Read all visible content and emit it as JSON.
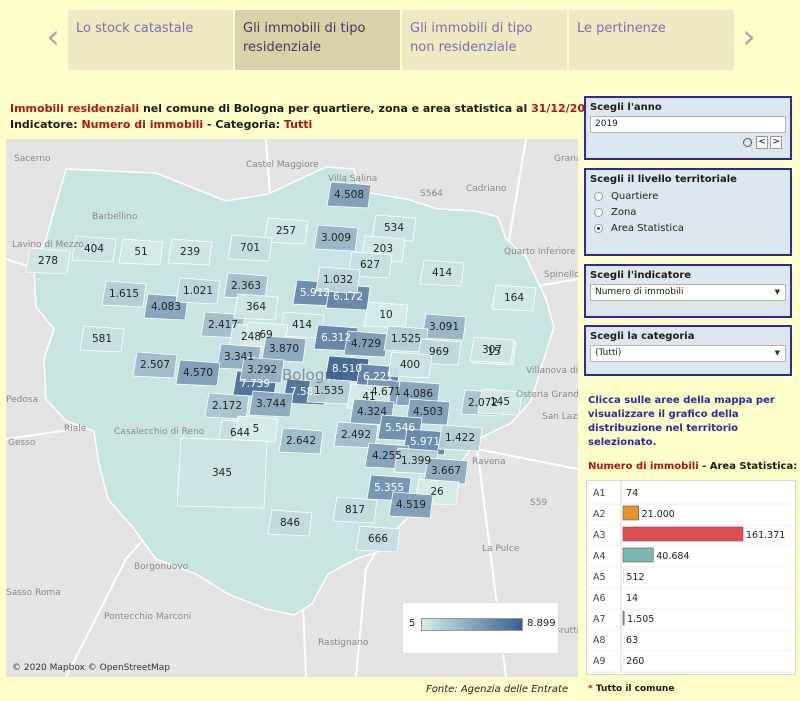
{
  "nav": {
    "tabs": [
      {
        "label": "Lo stock catastale",
        "active": false
      },
      {
        "label": "Gli immobili di tipo residenziale",
        "active": true
      },
      {
        "label": "Gli immobili di tipo non residenziale",
        "active": false
      },
      {
        "label": "Le pertinenze",
        "active": false
      }
    ],
    "prev_icon": "‹",
    "next_icon": "›"
  },
  "header": {
    "line1_prefix": "Immobili residenziali",
    "line1_middle": " nel comune di Bologna per quartiere, zona e area statistica al ",
    "line1_date": "31/12/2019",
    "line2_label": "Indicatore: ",
    "line2_indicator": "Numero di immobili",
    "line2_middle": " - Categoria: ",
    "line2_category": "Tutti"
  },
  "map": {
    "attribution": "© 2020 Mapbox © OpenStreetMap",
    "city_label": "Bologna",
    "legend": {
      "min": "5",
      "max": "8.899",
      "color_min": "#d6ede9",
      "color_max": "#3a5f8f"
    },
    "places": [
      "Sacerno",
      "Castel Maggiore",
      "Villa Salina",
      "Granarolo dell'E",
      "Cadriano",
      "Barbellino",
      "Lavino di Mezzo",
      "Quarto Inferiore",
      "Spinello",
      "Villanova di Castenaso",
      "Osteria Grande",
      "Riale",
      "Casalecchio di Reno",
      "Gesso",
      "Pedosa",
      "Ravena",
      "Borgonuovo",
      "Sasso Roma",
      "Pontecchio Marconi",
      "La Pulce",
      "Montecalvo",
      "Rastignano",
      "San Lazzaro",
      "Brutti",
      "S564",
      "S59"
    ],
    "area_values": [
      "278",
      "404",
      "51",
      "239",
      "257",
      "701",
      "4.508",
      "3.009",
      "534",
      "203",
      "627",
      "414",
      "164",
      "1.615",
      "4.083",
      "1.021",
      "2.363",
      "5.912",
      "6.172",
      "1.032",
      "581",
      "2.417",
      "364",
      "414",
      "10",
      "3.091",
      "2.507",
      "248",
      "69",
      "3.870",
      "6.312",
      "4.729",
      "1.525",
      "969",
      "15",
      "307",
      "3.341",
      "4.570",
      "8.510",
      "6.221",
      "4.671",
      "400",
      "7.739",
      "3.292",
      "7.581",
      "1.535",
      "41",
      "4.086",
      "2.072",
      "145",
      "2.172",
      "3.744",
      "4.324",
      "4.503",
      "644",
      "5",
      "2.642",
      "2.492",
      "5.546",
      "5.971",
      "1.422",
      "4.255",
      "1.399",
      "3.667",
      "345",
      "5.355",
      "26",
      "4.519",
      "846",
      "817",
      "666"
    ]
  },
  "source": "Fonte: Agenzia delle Entrate",
  "controls": {
    "year": {
      "title": "Scegli l'anno",
      "value": "2019",
      "prev": "<",
      "next": ">"
    },
    "level": {
      "title": "Scegli il livello territoriale",
      "options": [
        "Quartiere",
        "Zona",
        "Area Statistica"
      ],
      "selected": "Area Statistica"
    },
    "indicator": {
      "title": "Scegli l'indicatore",
      "value": "Numero di immobili"
    },
    "category": {
      "title": "Scegli la categoria",
      "value": "(Tutti)"
    }
  },
  "hint": "Clicca sulle aree della mappa per visualizzare il grafico della distribuzione nel territorio selezionato.",
  "bar_panel": {
    "title_indicator": "Numero di immobili",
    "title_rest": " - Area Statistica: ",
    "title_star": "*",
    "footnote_star": "*",
    "footnote": " Tutto il comune"
  },
  "chart_data": {
    "type": "bar",
    "orientation": "horizontal",
    "title": "Numero di immobili - Area Statistica: *",
    "categories": [
      "A1",
      "A2",
      "A3",
      "A4",
      "A5",
      "A6",
      "A7",
      "A8",
      "A9"
    ],
    "values": [
      74,
      21000,
      161371,
      40684,
      512,
      14,
      1505,
      63,
      260
    ],
    "value_labels": [
      "74",
      "21.000",
      "161.371",
      "40.684",
      "512",
      "14",
      "1.505",
      "63",
      "260"
    ],
    "colors": [
      "#8fa9c8",
      "#e8922e",
      "#e04d55",
      "#79b5b1",
      "#8fa9c8",
      "#8fa9c8",
      "#8fa9c8",
      "#8fa9c8",
      "#8fa9c8"
    ],
    "xlim": [
      0,
      161371
    ]
  }
}
